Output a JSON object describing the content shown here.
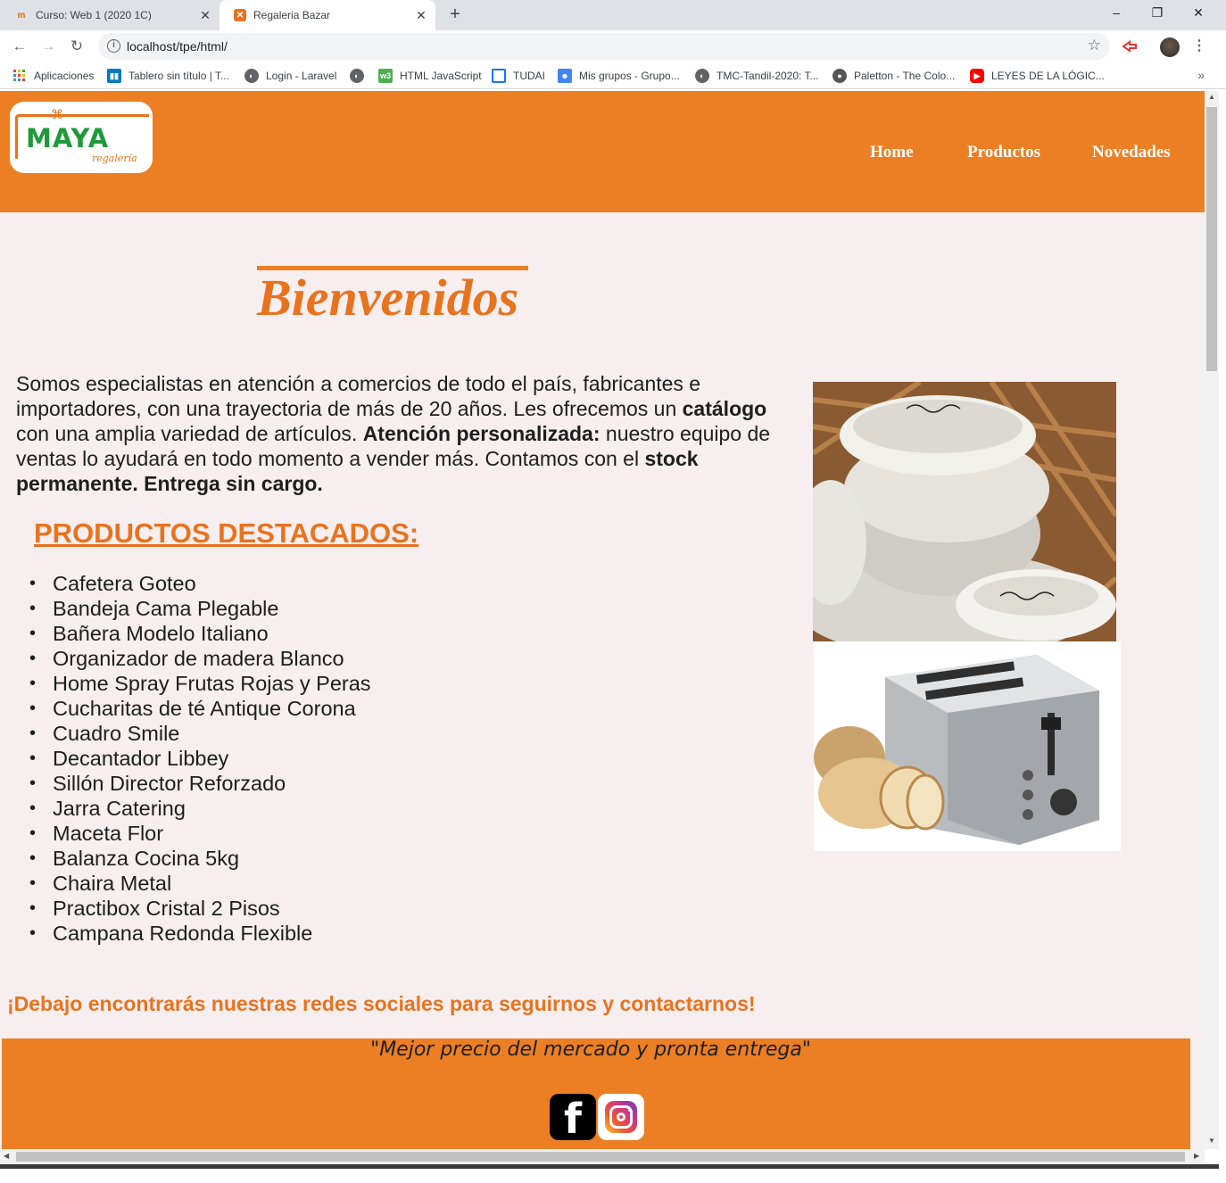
{
  "browser": {
    "tabs": [
      {
        "title": "Curso: Web 1 (2020 1C)",
        "favicon": "moodle-icon",
        "active": false
      },
      {
        "title": "Regaleria Bazar",
        "favicon": "xampp-icon",
        "active": true
      }
    ],
    "new_tab_symbol": "+",
    "window_controls": {
      "minimize": "–",
      "restore": "❐",
      "close": "✕"
    },
    "url": "localhost/tpe/html/",
    "bookmarks": [
      {
        "label": "Aplicaciones",
        "icon": "apps-grid-icon"
      },
      {
        "label": "Tablero sin título | T...",
        "icon": "trello-icon"
      },
      {
        "label": "Login - Laravel",
        "icon": "globe-icon"
      },
      {
        "label": "",
        "icon": "globe-icon"
      },
      {
        "label": "HTML JavaScript",
        "icon": "w3-icon"
      },
      {
        "label": "TUDAI",
        "icon": "tudai-icon"
      },
      {
        "label": "Mis grupos - Grupo...",
        "icon": "groups-icon"
      },
      {
        "label": "TMC-Tandil-2020: T...",
        "icon": "globe-icon"
      },
      {
        "label": "Paletton - The Colo...",
        "icon": "paletton-icon"
      },
      {
        "label": "LEYES DE LA LÓGIC...",
        "icon": "youtube-icon"
      }
    ],
    "more_bookmarks": "»"
  },
  "site": {
    "brand": "MAYA",
    "brand_sub": "regalería",
    "nav": [
      "Home",
      "Productos",
      "Novedades"
    ],
    "welcome": "Bienvenidos",
    "intro": {
      "p1": "Somos especialistas en atención a comercios de todo el país, fabricantes e importadores, con una trayectoria de más de 20 años. Les ofrecemos un ",
      "b1": "catálogo",
      "p2": " con una amplia variedad de artículos. ",
      "b2": "Atención personalizada:",
      "p3": " nuestro equipo de ventas lo ayudará en todo momento a vender más. Contamos con el ",
      "b3": "stock permanente. Entrega sin cargo."
    },
    "featured_title": "PRODUCTOS DESTACADOS:",
    "products": [
      "Cafetera Goteo",
      "Bandeja Cama Plegable",
      "Bañera Modelo Italiano",
      "Organizador de madera Blanco",
      "Home Spray Frutas Rojas y Peras",
      "Cucharitas de té Antique Corona",
      "Cuadro Smile",
      "Decantador Libbey",
      "Sillón Director Reforzado",
      "Jarra Catering",
      "Maceta Flor",
      "Balanza Cocina 5kg",
      "Chaira Metal",
      "Practibox Cristal 2 Pisos",
      "Campana Redonda Flexible"
    ],
    "social_callout": "¡Debajo encontrarás nuestras redes sociales para seguirnos y contactarnos!",
    "slogan": "\"Mejor precio del mercado y pronta entrega\"",
    "social_icons": [
      "facebook-icon",
      "instagram-icon"
    ],
    "colors": {
      "accent": "#ec7f24",
      "background": "#f6eeef",
      "logo_green": "#1f9a3a"
    }
  }
}
